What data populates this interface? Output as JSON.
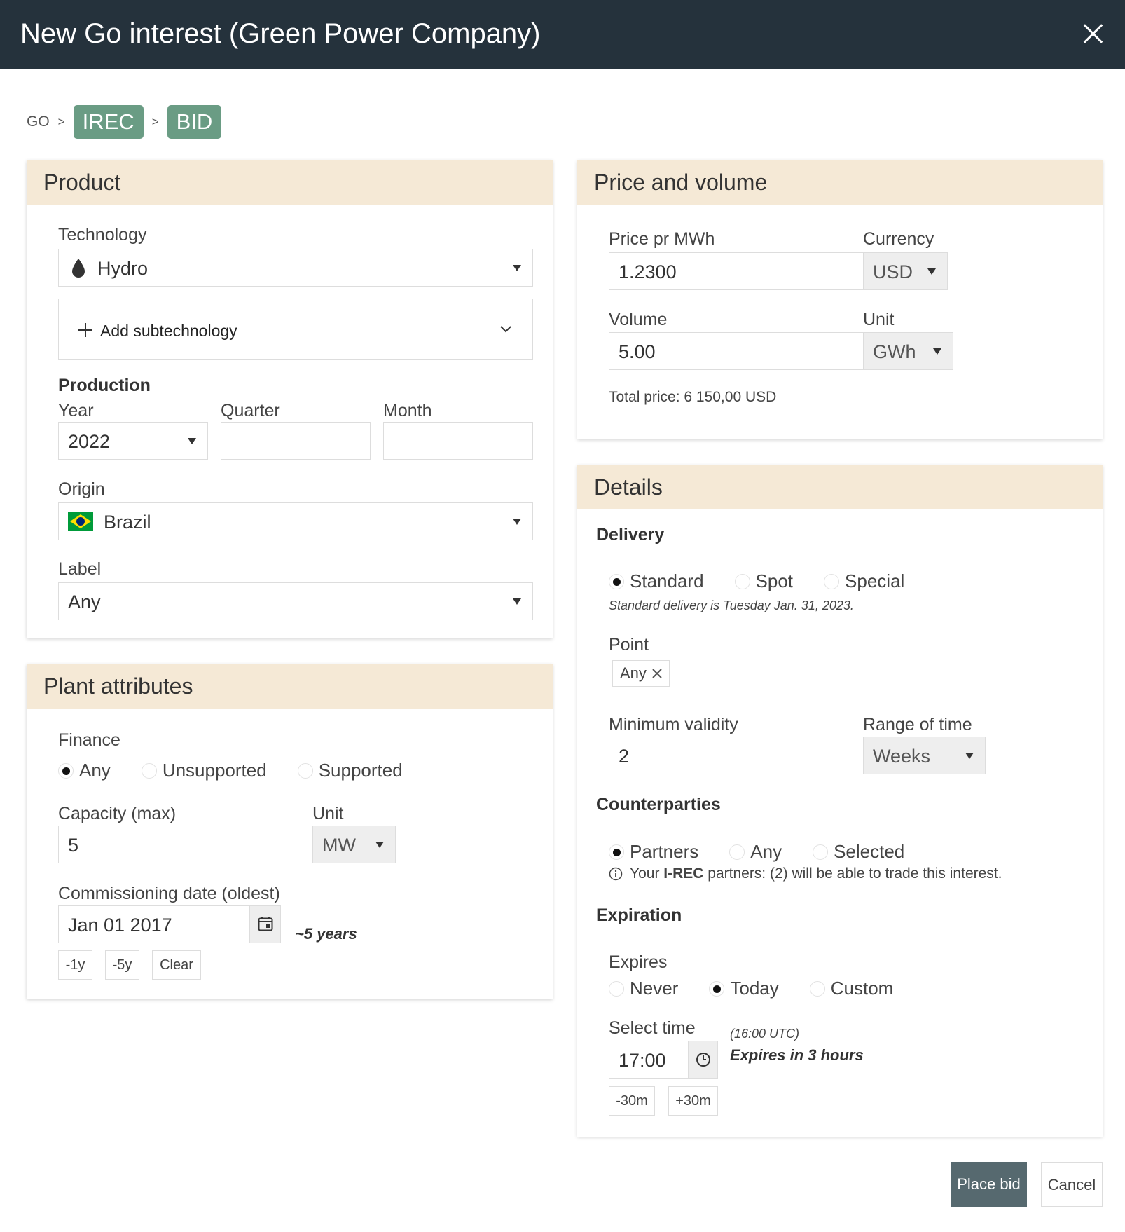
{
  "window": {
    "title": "New Go interest (Green Power Company)"
  },
  "breadcrumb": {
    "root": "GO",
    "sep": ">",
    "steps": [
      "IREC",
      "BID"
    ]
  },
  "product": {
    "heading": "Product",
    "technology_label": "Technology",
    "technology_value": "Hydro",
    "add_subtech": "Add subtechnology",
    "production_label": "Production",
    "year_label": "Year",
    "year_value": "2022",
    "quarter_label": "Quarter",
    "month_label": "Month",
    "origin_label": "Origin",
    "origin_value": "Brazil",
    "label_label": "Label",
    "label_value": "Any"
  },
  "plant": {
    "heading": "Plant attributes",
    "finance_label": "Finance",
    "finance_options": [
      "Any",
      "Unsupported",
      "Supported"
    ],
    "finance_selected": "Any",
    "capacity_label": "Capacity (max)",
    "capacity_value": "5",
    "unit_label": "Unit",
    "unit_value": "MW",
    "commissioning_label": "Commissioning date (oldest)",
    "commissioning_value": "Jan 01 2017",
    "approx_age": "~5 years",
    "buttons": [
      "-1y",
      "-5y",
      "Clear"
    ]
  },
  "price": {
    "heading": "Price and volume",
    "price_label": "Price pr MWh",
    "price_value": "1.2300",
    "currency_label": "Currency",
    "currency_value": "USD",
    "volume_label": "Volume",
    "volume_value": "5.00",
    "unit_label": "Unit",
    "unit_value": "GWh",
    "total": "Total price: 6 150,00 USD"
  },
  "details": {
    "heading": "Details",
    "delivery_label": "Delivery",
    "delivery_options": [
      "Standard",
      "Spot",
      "Special"
    ],
    "delivery_selected": "Standard",
    "delivery_note": "Standard delivery is Tuesday Jan. 31, 2023.",
    "point_label": "Point",
    "point_tag": "Any",
    "min_validity_label": "Minimum validity",
    "min_validity_value": "2",
    "range_label": "Range of time",
    "range_value": "Weeks",
    "counterparties_label": "Counterparties",
    "counterparty_options": [
      "Partners",
      "Any",
      "Selected"
    ],
    "counterparty_selected": "Partners",
    "partners_note_pre": "Your ",
    "partners_note_bold": "I-REC",
    "partners_note_post": " partners: (2) will be able to trade this interest.",
    "expiration_label": "Expiration",
    "expires_label": "Expires",
    "expires_options": [
      "Never",
      "Today",
      "Custom"
    ],
    "expires_selected": "Today",
    "select_time_label": "Select time",
    "time_value": "17:00",
    "utc_note": "(16:00 UTC)",
    "expires_in": "Expires in 3 hours",
    "time_buttons": [
      "-30m",
      "+30m"
    ]
  },
  "actions": {
    "place_bid": "Place bid",
    "cancel": "Cancel"
  },
  "colors": {
    "titlebar": "#25323c",
    "panel_header": "#f5e9d6",
    "pill": "#6a9c84",
    "primary_button": "#56696f"
  }
}
